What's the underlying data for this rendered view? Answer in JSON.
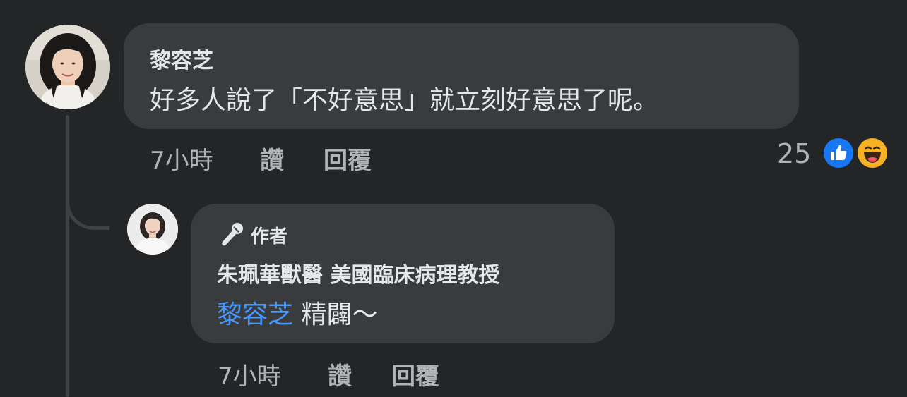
{
  "main_comment": {
    "author": "黎容芝",
    "text": "好多人說了「不好意思」就立刻好意思了呢。",
    "time": "7小時",
    "like_label": "讚",
    "reply_label": "回覆",
    "reaction_count": "25",
    "reactions": [
      "like-icon",
      "haha-icon"
    ]
  },
  "reply_comment": {
    "badge": "作者",
    "badge_icon": "microphone-icon",
    "author": "朱珮華獸醫 美國臨床病理教授",
    "mention": "黎容芝",
    "text": "精闢～",
    "time": "7小時",
    "like_label": "讚",
    "reply_label": "回覆"
  },
  "colors": {
    "background": "#242526",
    "bubble": "#3a3b3c",
    "text": "#e4e6eb",
    "secondary_text": "#b0b3b8",
    "mention": "#4599ff",
    "like_blue": "#1877f2",
    "haha_yellow": "#f7b125"
  }
}
